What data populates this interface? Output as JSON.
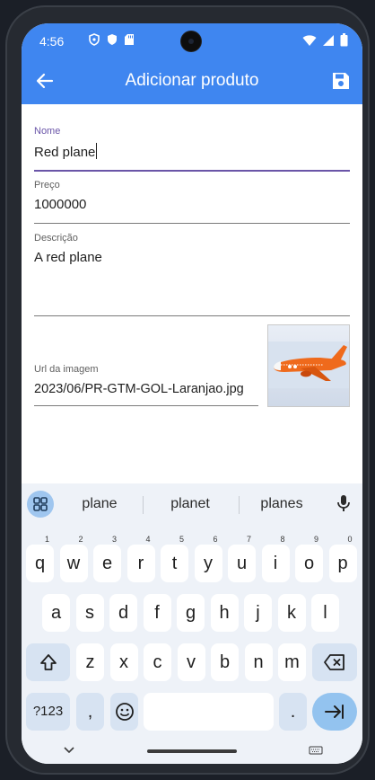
{
  "status": {
    "time": "4:56"
  },
  "appbar": {
    "title": "Adicionar produto"
  },
  "form": {
    "name": {
      "label": "Nome",
      "value": "Red plane"
    },
    "price": {
      "label": "Preço",
      "value": "1000000"
    },
    "description": {
      "label": "Descrição",
      "value": "A red plane"
    },
    "image_url": {
      "label": "Url da imagem",
      "value": "2023/06/PR-GTM-GOL-Laranjao.jpg"
    }
  },
  "keyboard": {
    "suggestions": [
      "plane",
      "planet",
      "planes"
    ],
    "row1": [
      {
        "k": "q",
        "h": "1"
      },
      {
        "k": "w",
        "h": "2"
      },
      {
        "k": "e",
        "h": "3"
      },
      {
        "k": "r",
        "h": "4"
      },
      {
        "k": "t",
        "h": "5"
      },
      {
        "k": "y",
        "h": "6"
      },
      {
        "k": "u",
        "h": "7"
      },
      {
        "k": "i",
        "h": "8"
      },
      {
        "k": "o",
        "h": "9"
      },
      {
        "k": "p",
        "h": "0"
      }
    ],
    "row2": [
      "a",
      "s",
      "d",
      "f",
      "g",
      "h",
      "j",
      "k",
      "l"
    ],
    "row3": [
      "z",
      "x",
      "c",
      "v",
      "b",
      "n",
      "m"
    ],
    "symbols_label": "?123",
    "comma": ",",
    "period": "."
  },
  "colors": {
    "primary": "#3f86f0",
    "focus": "#6a55a8",
    "keyboard_bg": "#eef2f8"
  }
}
